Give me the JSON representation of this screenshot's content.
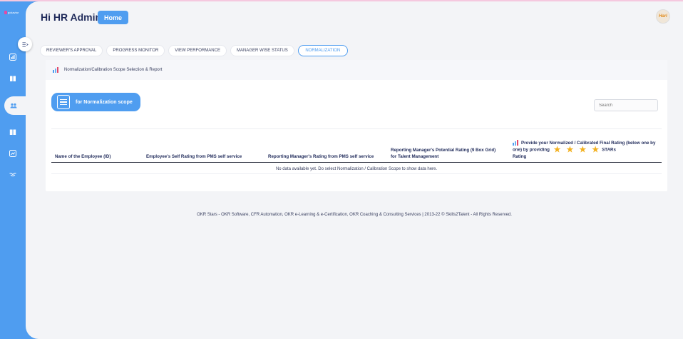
{
  "brand": {
    "name": "gokaviar"
  },
  "header": {
    "greeting": "Hi HR Admin",
    "home_label": "Home",
    "avatar_text": "Hari"
  },
  "sidebar": {
    "items": [
      {
        "icon": "chart-icon"
      },
      {
        "icon": "book-icon"
      },
      {
        "icon": "users-icon",
        "active": true
      },
      {
        "icon": "book-open-icon"
      },
      {
        "icon": "report-icon"
      },
      {
        "icon": "handshake-icon"
      }
    ]
  },
  "tabs": [
    {
      "label": "REVIEWER'S APPROVAL"
    },
    {
      "label": "PROGRESS MONITOR"
    },
    {
      "label": "VIEW PERFORMANCE"
    },
    {
      "label": "MANAGER WISE STATUS"
    },
    {
      "label": "NORMALIZATION",
      "active": true
    }
  ],
  "card": {
    "title": "Normalization/Calibration Scope Selection & Report",
    "scope_button": "for Normalization scope",
    "search_placeholder": "Search"
  },
  "table": {
    "columns": [
      "Name of the Employee (ID)",
      "Employee's Self Rating from PMS self service",
      "Reporting Manager's Rating from PMS self service",
      "Reporting Manager's Potential Rating (9 Box Grid) for Talent Management",
      "Provide your Normalized / Calibrated Final Rating (below one by one) by providing"
    ],
    "last_col_suffix": "STARs",
    "last_col_tail": "Rating",
    "empty_message": "No data available yet. Do select Normalization / Calibration Scope to show data here."
  },
  "footer": {
    "text": "OKR Stars - OKR Software, CFR Automation, OKR e-Learning & e-Certification, OKR Coaching & Consulting Services | 2013-22 © Skills2Talent - All Rights Reserved."
  },
  "colors": {
    "accent": "#4f9df0",
    "star": "#f2b01e",
    "text": "#1f2a5a"
  }
}
